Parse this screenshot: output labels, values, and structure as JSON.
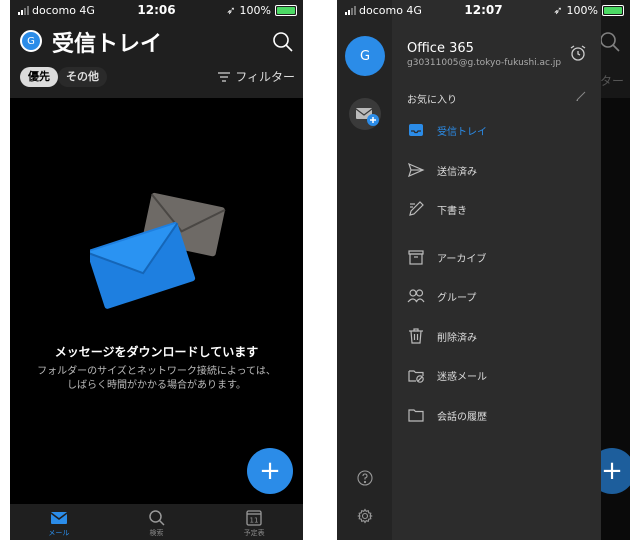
{
  "left": {
    "status": {
      "carrier": "docomo 4G",
      "time": "12:06",
      "battery": "100%"
    },
    "avatar_initial": "G",
    "title": "受信トレイ",
    "tabs": {
      "focused": "優先",
      "other": "その他"
    },
    "filter_label": "フィルター",
    "empty": {
      "title": "メッセージをダウンロードしています",
      "line1": "フォルダーのサイズとネットワーク接続によっては、",
      "line2": "しばらく時間がかかる場合があります。"
    },
    "fab": "+",
    "nav": [
      {
        "label": "メール",
        "icon": "mail-icon"
      },
      {
        "label": "検索",
        "icon": "search-icon"
      },
      {
        "label": "予定表",
        "icon": "calendar-icon"
      }
    ],
    "calendar_day": "11"
  },
  "right": {
    "status": {
      "carrier": "docomo 4G",
      "time": "12:07",
      "battery": "100%"
    },
    "account": {
      "initial": "G",
      "name": "Office 365",
      "email": "g30311005@g.tokyo-fukushi.ac.jp"
    },
    "favorites_label": "お気に入り",
    "folders": [
      {
        "label": "受信トレイ",
        "icon": "inbox-icon",
        "active": true
      },
      {
        "label": "送信済み",
        "icon": "sent-icon"
      },
      {
        "label": "下書き",
        "icon": "drafts-icon"
      },
      {
        "label": "アーカイブ",
        "icon": "archive-icon"
      },
      {
        "label": "グループ",
        "icon": "groups-icon"
      },
      {
        "label": "削除済み",
        "icon": "trash-icon"
      },
      {
        "label": "迷惑メール",
        "icon": "junk-icon"
      },
      {
        "label": "会話の履歴",
        "icon": "folder-icon"
      }
    ],
    "ghost_filter": "ター",
    "fab": "+"
  },
  "colors": {
    "accent": "#2b8ce8",
    "background": "#000000",
    "drawer": "#2c2c2c"
  }
}
